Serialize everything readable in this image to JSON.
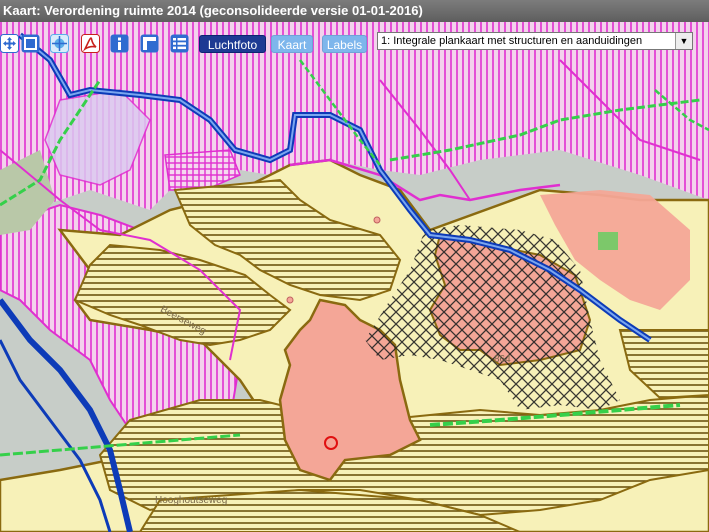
{
  "window": {
    "title": "Kaart: Verordening ruimte 2014 (geconsolideerde versie 01-01-2016)"
  },
  "toolbar": {
    "tools": [
      {
        "name": "pan-tool",
        "icon": "arrows-icon",
        "color": "#2f6bd0"
      },
      {
        "name": "zoom-box-tool",
        "icon": "zoom-box-icon",
        "color": "#2f6bd0"
      },
      {
        "name": "full-extent-tool",
        "icon": "globe-icon",
        "color": "#5aaeea"
      },
      {
        "name": "pdf-export-tool",
        "icon": "pdf-icon",
        "color": "#c8201c"
      },
      {
        "name": "info-tool",
        "icon": "info-icon",
        "color": "#2f6bd0"
      },
      {
        "name": "measure-tool",
        "icon": "ruler-icon",
        "color": "#2f6bd0"
      },
      {
        "name": "legend-tool",
        "icon": "list-icon",
        "color": "#2f6bd0"
      }
    ],
    "layers": [
      {
        "label": "Luchtfoto",
        "active": true
      },
      {
        "label": "Kaart",
        "active": false
      },
      {
        "label": "Labels",
        "active": false
      }
    ],
    "map_select": {
      "value": "1: Integrale plankaart met structuren en aanduidingen"
    }
  },
  "map": {
    "labels": [
      {
        "text": "Beerseweg"
      },
      {
        "text": "864"
      },
      {
        "text": "Hooghoutseweg"
      }
    ]
  },
  "colors": {
    "magenta": "#e02fd0",
    "brown": "#8a6a10",
    "yellowfill": "#f7f1b8",
    "salmon": "#f4a697",
    "blue": "#0d3bb8",
    "green": "#35d04a"
  }
}
